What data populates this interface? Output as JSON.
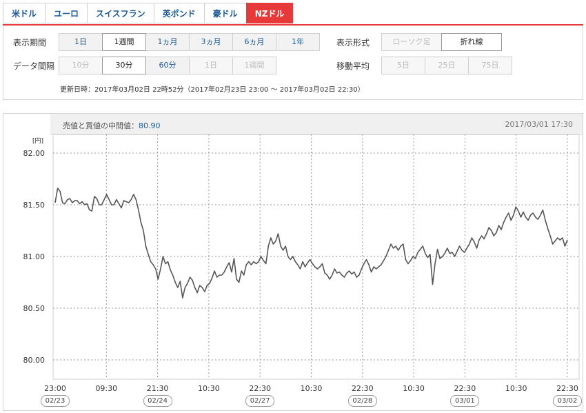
{
  "tabs": [
    {
      "label": "米ドル",
      "active": false
    },
    {
      "label": "ユーロ",
      "active": false
    },
    {
      "label": "スイスフラン",
      "active": false
    },
    {
      "label": "英ポンド",
      "active": false
    },
    {
      "label": "豪ドル",
      "active": false
    },
    {
      "label": "NZドル",
      "active": true
    }
  ],
  "panel": {
    "period_label": "表示期間",
    "period_options": [
      "1日",
      "1週間",
      "1ヵ月",
      "3ヵ月",
      "6ヵ月",
      "1年"
    ],
    "period_selected": "1週間",
    "interval_label": "データ間隔",
    "interval_options": [
      "10分",
      "30分",
      "60分",
      "1日",
      "1週間"
    ],
    "interval_selected": "30分",
    "interval_disabled": [
      "10分",
      "1日",
      "1週間"
    ],
    "format_label": "表示形式",
    "format_options": [
      "ローソク足",
      "折れ線"
    ],
    "format_selected": "折れ線",
    "format_disabled": [
      "ローソク足"
    ],
    "ma_label": "移動平均",
    "ma_options": [
      "5日",
      "25日",
      "75日"
    ],
    "ma_disabled": [
      "5日",
      "25日",
      "75日"
    ],
    "update_text": "更新日時：2017年03月02日 22時52分（2017年02月23日 23:00 ～ 2017年03月02日 22:30）"
  },
  "chart_head": {
    "mid_label": "売値と買値の中間値：",
    "mid_value": "80.90",
    "timestamp": "2017/03/01 17:30"
  },
  "chart_data": {
    "type": "line",
    "ylabel": "[円]",
    "ylim": [
      80.0,
      82.0
    ],
    "yticks": [
      "82.00",
      "81.50",
      "81.00",
      "80.50",
      "80.00"
    ],
    "xticks": [
      "23:00",
      "09:30",
      "21:30",
      "10:30",
      "22:30",
      "10:30",
      "22:30",
      "10:30",
      "22:30",
      "10:30",
      "22:30"
    ],
    "date_labels": [
      "02/23",
      "02/24",
      "02/27",
      "02/28",
      "03/01",
      "03/02"
    ],
    "grid": true,
    "line_color": "#555555",
    "values": [
      81.52,
      81.66,
      81.63,
      81.52,
      81.51,
      81.55,
      81.56,
      81.52,
      81.54,
      81.54,
      81.51,
      81.53,
      81.5,
      81.51,
      81.45,
      81.44,
      81.58,
      81.56,
      81.5,
      81.5,
      81.55,
      81.6,
      81.55,
      81.5,
      81.5,
      81.55,
      81.51,
      81.47,
      81.54,
      81.53,
      81.52,
      81.55,
      81.6,
      81.55,
      81.45,
      81.33,
      81.25,
      81.1,
      81.02,
      80.95,
      80.92,
      80.88,
      80.78,
      80.88,
      81.0,
      80.93,
      80.95,
      80.87,
      80.82,
      80.75,
      80.7,
      80.76,
      80.6,
      80.7,
      80.74,
      80.8,
      80.77,
      80.7,
      80.65,
      80.72,
      80.7,
      80.66,
      80.72,
      80.74,
      80.79,
      80.86,
      80.8,
      80.82,
      80.82,
      80.85,
      80.9,
      80.94,
      80.85,
      80.98,
      80.78,
      80.75,
      80.86,
      80.82,
      80.92,
      80.95,
      80.92,
      80.95,
      80.93,
      80.95,
      81.0,
      80.96,
      80.93,
      81.1,
      81.18,
      81.12,
      81.15,
      81.22,
      81.1,
      81.06,
      81.1,
      81.0,
      80.97,
      81.0,
      80.95,
      80.92,
      80.88,
      80.95,
      80.9,
      80.94,
      80.97,
      80.93,
      80.9,
      80.88,
      80.9,
      80.93,
      80.84,
      80.82,
      80.78,
      80.82,
      80.88,
      80.84,
      80.85,
      80.82,
      80.8,
      80.84,
      80.86,
      80.83,
      80.85,
      80.8,
      80.82,
      80.88,
      80.93,
      80.97,
      80.92,
      80.85,
      80.9,
      80.88,
      80.9,
      80.92,
      80.96,
      81.0,
      81.06,
      81.12,
      81.08,
      81.1,
      81.06,
      81.1,
      81.12,
      80.97,
      80.93,
      80.96,
      81.0,
      80.98,
      81.04,
      81.07,
      81.1,
      81.03,
      80.99,
      81.02,
      80.73,
      80.93,
      81.07,
      80.98,
      81.0,
      81.03,
      81.08,
      81.03,
      81.04,
      81.0,
      81.05,
      81.1,
      81.06,
      81.04,
      81.08,
      81.12,
      81.18,
      81.14,
      81.08,
      81.16,
      81.2,
      81.17,
      81.22,
      81.28,
      81.25,
      81.2,
      81.23,
      81.3,
      81.26,
      81.33,
      81.38,
      81.42,
      81.35,
      81.4,
      81.48,
      81.44,
      81.38,
      81.43,
      81.38,
      81.35,
      81.4,
      81.42,
      81.38,
      81.36,
      81.4,
      81.45,
      81.35,
      81.27,
      81.2,
      81.12,
      81.15,
      81.18,
      81.16,
      81.18,
      81.1,
      81.16
    ]
  }
}
